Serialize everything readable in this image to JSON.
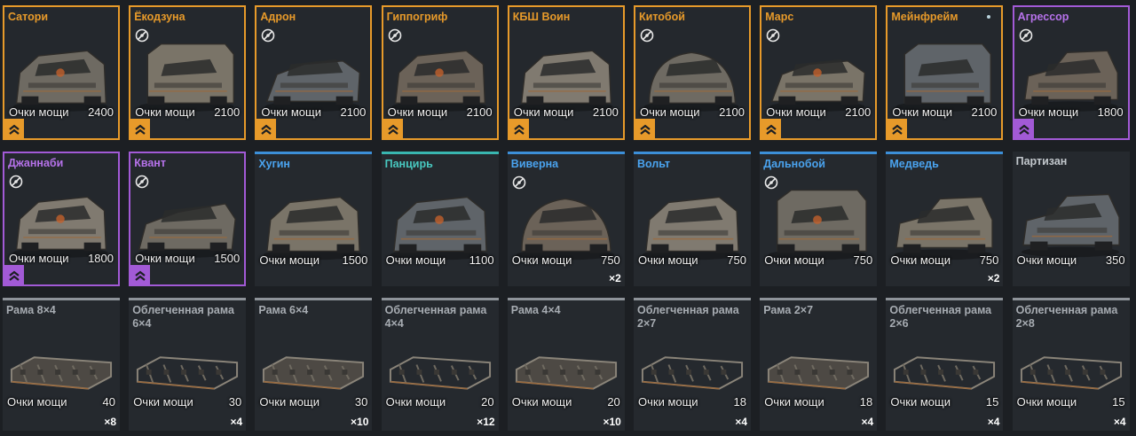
{
  "stat_label": "Очки мощи",
  "colors": {
    "legendary": "#e79a2a",
    "epic": "#a25ad6",
    "rare": "#3c8fd8",
    "special": "#39b6b0",
    "common": "#8e9399"
  },
  "rows": [
    [
      {
        "name": "Сатори",
        "rarity": "legendary",
        "power": "2400",
        "locked": false,
        "badge": true,
        "count": "",
        "icon": "car-cabin"
      },
      {
        "name": "Ёкодзуна",
        "rarity": "legendary",
        "power": "2100",
        "locked": true,
        "badge": true,
        "count": "",
        "icon": "truck-cabin"
      },
      {
        "name": "Адрон",
        "rarity": "legendary",
        "power": "2100",
        "locked": true,
        "badge": true,
        "count": "",
        "icon": "tracked-cabin"
      },
      {
        "name": "Гиппогриф",
        "rarity": "legendary",
        "power": "2100",
        "locked": true,
        "badge": true,
        "count": "",
        "icon": "buggy-cabin"
      },
      {
        "name": "КБШ Воин",
        "rarity": "legendary",
        "power": "2100",
        "locked": false,
        "badge": true,
        "count": "",
        "icon": "armored-cabin"
      },
      {
        "name": "Китобой",
        "rarity": "legendary",
        "power": "2100",
        "locked": true,
        "badge": true,
        "count": "",
        "icon": "hover-cabin"
      },
      {
        "name": "Марс",
        "rarity": "legendary",
        "power": "2100",
        "locked": true,
        "badge": true,
        "count": "",
        "icon": "tank-cabin"
      },
      {
        "name": "Мейнфрейм",
        "rarity": "legendary",
        "power": "2100",
        "locked": false,
        "badge": true,
        "count": "",
        "icon": "heavy-cabin",
        "dot": true
      },
      {
        "name": "Агрессор",
        "rarity": "epic",
        "power": "1800",
        "locked": true,
        "badge": true,
        "count": "",
        "icon": "pickup-cabin"
      }
    ],
    [
      {
        "name": "Джаннаби",
        "rarity": "epic",
        "power": "1800",
        "locked": true,
        "badge": true,
        "count": "",
        "icon": "car-cabin"
      },
      {
        "name": "Квант",
        "rarity": "epic",
        "power": "1500",
        "locked": true,
        "badge": true,
        "count": "",
        "icon": "sleek-cabin"
      },
      {
        "name": "Хугин",
        "rarity": "rare",
        "power": "1500",
        "locked": false,
        "badge": false,
        "count": "",
        "icon": "buggy-cabin"
      },
      {
        "name": "Панцирь",
        "rarity": "special",
        "power": "1100",
        "locked": false,
        "badge": false,
        "count": "",
        "icon": "armored-cabin"
      },
      {
        "name": "Виверна",
        "rarity": "rare",
        "power": "750",
        "locked": true,
        "badge": false,
        "count": "×2",
        "icon": "round-cabin"
      },
      {
        "name": "Вольт",
        "rarity": "rare",
        "power": "750",
        "locked": false,
        "badge": false,
        "count": "",
        "icon": "cabin"
      },
      {
        "name": "Дальнобой",
        "rarity": "rare",
        "power": "750",
        "locked": true,
        "badge": false,
        "count": "",
        "icon": "truck-cabin"
      },
      {
        "name": "Медведь",
        "rarity": "rare",
        "power": "750",
        "locked": false,
        "badge": false,
        "count": "×2",
        "icon": "pickup-cabin"
      },
      {
        "name": "Партизан",
        "rarity": "none",
        "power": "350",
        "locked": false,
        "badge": false,
        "count": "",
        "icon": "pickup-cabin"
      }
    ],
    [
      {
        "name": "Рама 8×4",
        "rarity": "common",
        "power": "40",
        "locked": false,
        "badge": false,
        "count": "×8",
        "icon": "frame"
      },
      {
        "name": "Облегченная рама 6×4",
        "rarity": "common",
        "power": "30",
        "locked": false,
        "badge": false,
        "count": "×4",
        "icon": "light-frame"
      },
      {
        "name": "Рама 6×4",
        "rarity": "common",
        "power": "30",
        "locked": false,
        "badge": false,
        "count": "×10",
        "icon": "frame"
      },
      {
        "name": "Облегченная рама 4×4",
        "rarity": "common",
        "power": "20",
        "locked": false,
        "badge": false,
        "count": "×12",
        "icon": "light-frame"
      },
      {
        "name": "Рама 4×4",
        "rarity": "common",
        "power": "20",
        "locked": false,
        "badge": false,
        "count": "×10",
        "icon": "frame"
      },
      {
        "name": "Облегченная рама 2×7",
        "rarity": "common",
        "power": "18",
        "locked": false,
        "badge": false,
        "count": "×4",
        "icon": "light-frame"
      },
      {
        "name": "Рама 2×7",
        "rarity": "common",
        "power": "18",
        "locked": false,
        "badge": false,
        "count": "×4",
        "icon": "frame"
      },
      {
        "name": "Облегченная рама 2×6",
        "rarity": "common",
        "power": "15",
        "locked": false,
        "badge": false,
        "count": "×4",
        "icon": "light-frame"
      },
      {
        "name": "Облегченная рама 2×8",
        "rarity": "common",
        "power": "15",
        "locked": false,
        "badge": false,
        "count": "×4",
        "icon": "light-frame"
      }
    ]
  ]
}
